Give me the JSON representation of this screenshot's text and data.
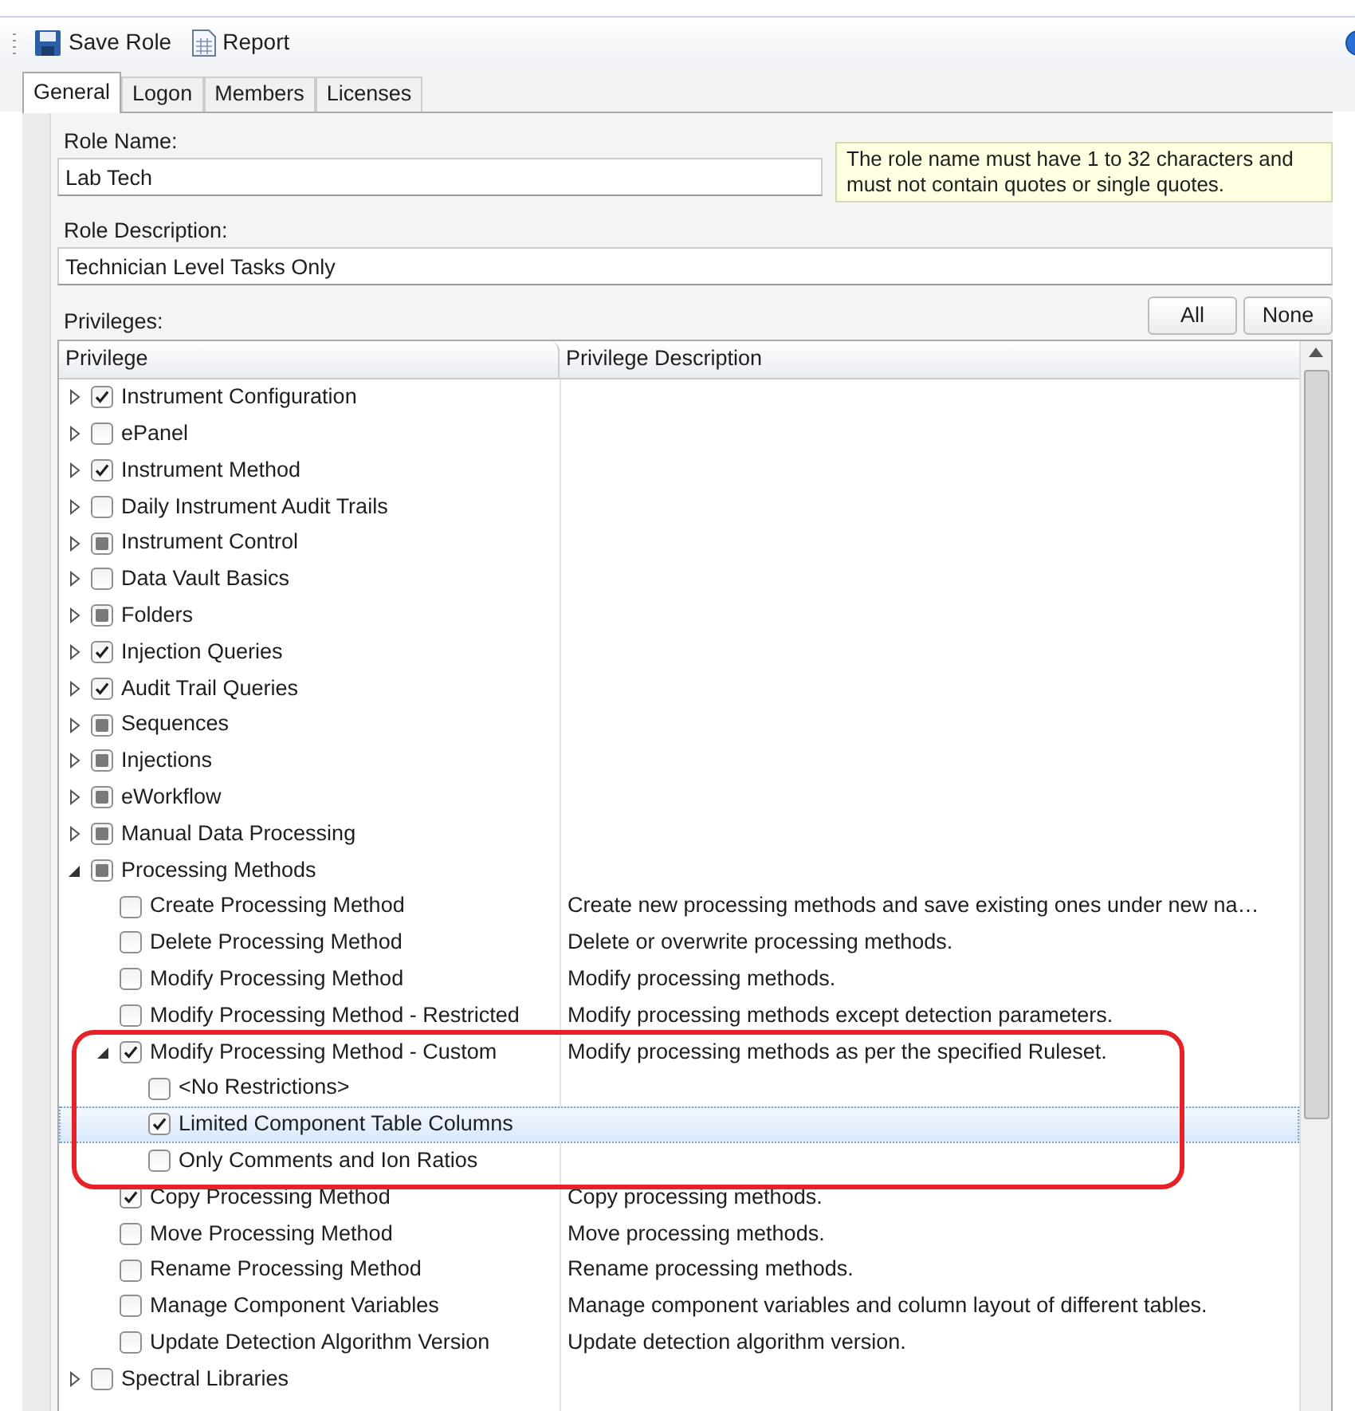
{
  "toolbar": {
    "buttons": [
      {
        "kind": "save",
        "label": "Save Role"
      },
      {
        "kind": "report",
        "label": "Report"
      }
    ]
  },
  "tabs": [
    {
      "label": "General",
      "selected": true
    },
    {
      "label": "Logon",
      "selected": false
    },
    {
      "label": "Members",
      "selected": false
    },
    {
      "label": "Licenses",
      "selected": false
    }
  ],
  "role_name": {
    "label": "Role Name:",
    "value": "Lab Tech"
  },
  "hint": "The role name must have 1 to 32 characters and must not contain quotes or single quotes.",
  "role_description": {
    "label": "Role Description:",
    "value": "Technician Level Tasks Only"
  },
  "privileges": {
    "label": "Privileges:",
    "buttons": [
      "All",
      "None"
    ],
    "columns": [
      "Privilege",
      "Privilege Description"
    ],
    "rows": [
      {
        "name": "Instrument Configuration",
        "checked": true,
        "partial": false,
        "expanded": false,
        "children": []
      },
      {
        "name": "ePanel",
        "checked": false,
        "partial": false,
        "expanded": false,
        "children": []
      },
      {
        "name": "Instrument Method",
        "checked": true,
        "partial": false,
        "expanded": false,
        "children": []
      },
      {
        "name": "Daily Instrument Audit Trails",
        "checked": false,
        "partial": false,
        "expanded": false,
        "children": []
      },
      {
        "name": "Instrument Control",
        "checked": false,
        "partial": true,
        "expanded": false,
        "children": []
      },
      {
        "name": "Data Vault Basics",
        "checked": false,
        "partial": false,
        "expanded": false,
        "children": []
      },
      {
        "name": "Folders",
        "checked": false,
        "partial": true,
        "expanded": false,
        "children": []
      },
      {
        "name": "Injection Queries",
        "checked": true,
        "partial": false,
        "expanded": false,
        "children": []
      },
      {
        "name": "Audit Trail Queries",
        "checked": true,
        "partial": false,
        "expanded": false,
        "children": []
      },
      {
        "name": "Sequences",
        "checked": false,
        "partial": true,
        "expanded": false,
        "children": []
      },
      {
        "name": "Injections",
        "checked": false,
        "partial": true,
        "expanded": false,
        "children": []
      },
      {
        "name": "eWorkflow",
        "checked": false,
        "partial": true,
        "expanded": false,
        "children": []
      },
      {
        "name": "Manual Data Processing",
        "checked": false,
        "partial": true,
        "expanded": false,
        "children": []
      },
      {
        "name": "Processing Methods",
        "checked": false,
        "partial": true,
        "expanded": true,
        "children": [
          {
            "name": "Create Processing Method",
            "checked": false,
            "partial": false,
            "description": "Create new processing methods and save existing ones under new na…"
          },
          {
            "name": "Delete Processing Method",
            "checked": false,
            "partial": false,
            "description": "Delete or overwrite processing methods."
          },
          {
            "name": "Modify Processing Method",
            "checked": false,
            "partial": false,
            "description": "Modify processing methods."
          },
          {
            "name": "Modify Processing Method - Restricted",
            "checked": false,
            "partial": false,
            "description": "Modify processing methods except detection parameters."
          },
          {
            "name": "Modify Processing Method - Custom",
            "checked": true,
            "partial": false,
            "expanded": true,
            "highlighted": true,
            "description": "Modify processing methods as per the specified Ruleset.",
            "children": [
              {
                "name": "<No Restrictions>",
                "checked": false,
                "partial": false,
                "selected": false
              },
              {
                "name": "Limited Component Table Columns",
                "checked": true,
                "partial": false,
                "selected": true
              },
              {
                "name": "Only Comments and Ion Ratios",
                "checked": false,
                "partial": false,
                "selected": false
              }
            ]
          },
          {
            "name": "Copy Processing Method",
            "checked": true,
            "partial": false,
            "description": "Copy processing methods."
          },
          {
            "name": "Move Processing Method",
            "checked": false,
            "partial": false,
            "description": "Move processing methods."
          },
          {
            "name": "Rename Processing Method",
            "checked": false,
            "partial": false,
            "description": "Rename processing methods."
          },
          {
            "name": "Manage Component Variables",
            "checked": false,
            "partial": false,
            "description": "Manage component variables and column layout of different tables."
          },
          {
            "name": "Update Detection Algorithm Version",
            "checked": false,
            "partial": false,
            "description": "Update detection algorithm version."
          }
        ]
      },
      {
        "name": "Spectral Libraries",
        "checked": false,
        "partial": false,
        "expanded": false,
        "children": []
      }
    ]
  }
}
